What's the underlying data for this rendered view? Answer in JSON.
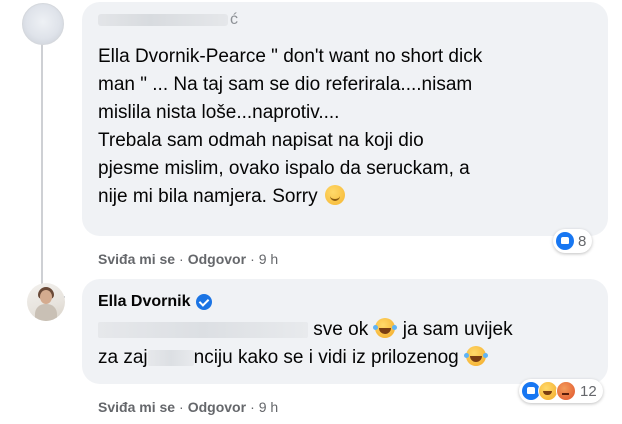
{
  "comments": [
    {
      "author_tail": "ć",
      "text_lines": [
        "Ella Dvornik-Pearce \" don't want no short dick",
        "man \" ... Na taj sam se dio referirala....nisam",
        "mislila nista loše...naprotiv....",
        "Trebala sam odmah napisat na koji dio",
        "pjesme mislim, ovako ispalo da seruckam, a",
        "nije mi bila namjera. Sorry"
      ],
      "like_label": "Sviđa mi se",
      "reply_label": "Odgovor",
      "dot": "·",
      "time": "9 h",
      "reaction_count": "8",
      "reaction_icons": [
        "like-icon"
      ]
    },
    {
      "author": "Ella Dvornik",
      "text_line1_after_redact": "sve ok",
      "text_line1_end": "ja sam uvijek",
      "text_line2_start": "za zaj",
      "text_line2_mid": "nciju kako se i vidi iz prilozenog",
      "like_label": "Sviđa mi se",
      "reply_label": "Odgovor",
      "dot": "·",
      "time": "9 h",
      "reaction_count": "12",
      "reaction_icons": [
        "like-icon",
        "haha-icon",
        "angry-icon"
      ]
    }
  ],
  "colors": {
    "bubble": "#f0f2f5",
    "meta_text": "#65676b",
    "like_blue": "#1877f2",
    "verified_blue": "#1b74e4"
  }
}
